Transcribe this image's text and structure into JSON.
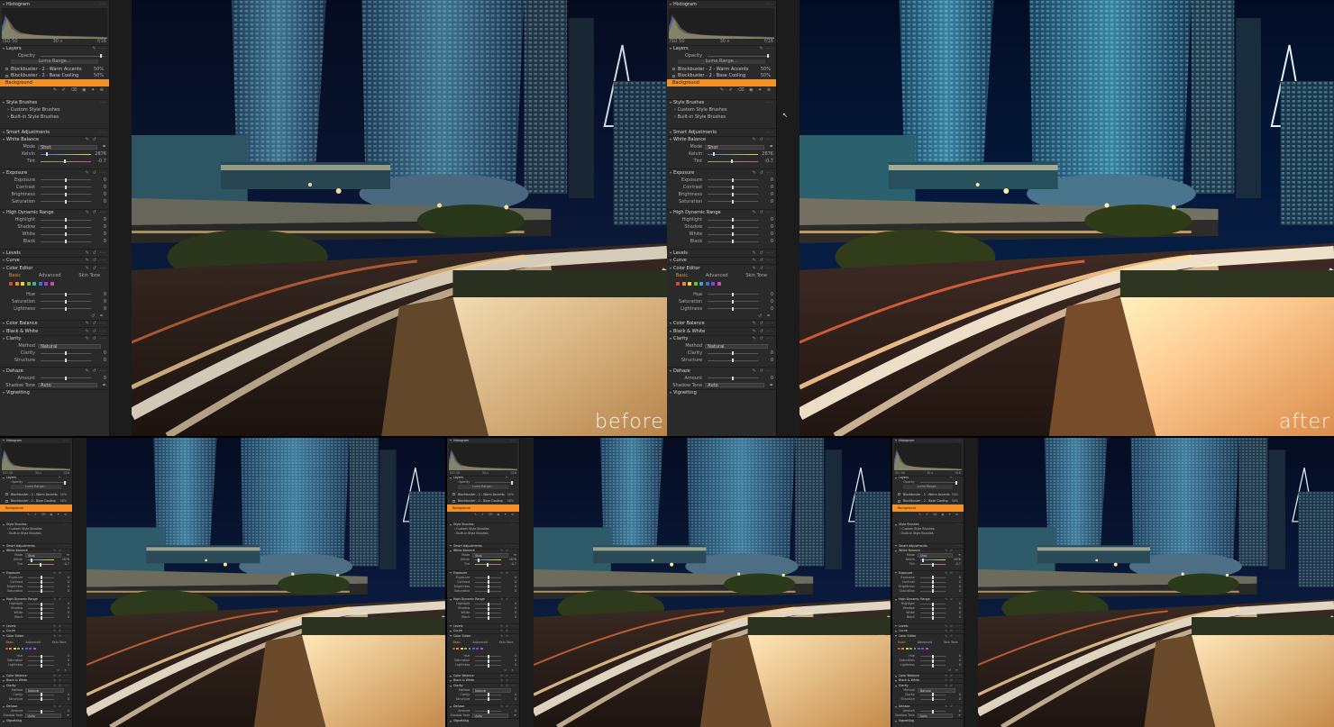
{
  "panel": {
    "histogram_title": "Histogram",
    "iso": "ISO 50",
    "shutter": "30 s",
    "aperture": "f/16",
    "layers_title": "Layers",
    "opacity_label": "Opacity",
    "luma_range": "Luma Range...",
    "layers": [
      {
        "name": "Blockbuster - 2 - Warm Accents",
        "pct": "50%"
      },
      {
        "name": "Blockbuster - 2 - Base Cooling",
        "pct": "50%"
      },
      {
        "name": "Background",
        "pct": ""
      }
    ],
    "style_brushes_title": "Style Brushes",
    "custom_brushes": "Custom Style Brushes",
    "builtin_brushes": "Built-in Style Brushes",
    "smart_adjustments": "Smart Adjustments",
    "white_balance": "White Balance",
    "mode_label": "Mode",
    "mode_value": "Shot",
    "kelvin_label": "Kelvin",
    "kelvin_value": "2876",
    "tint_label": "Tint",
    "tint_value": "-0.7",
    "exposure_title": "Exposure",
    "exposure_rows": [
      "Exposure",
      "Contrast",
      "Brightness",
      "Saturation"
    ],
    "hdr_title": "High Dynamic Range",
    "hdr_rows": [
      "Highlight",
      "Shadow",
      "White",
      "Black"
    ],
    "zero": "0",
    "levels": "Levels",
    "curve": "Curve",
    "color_editor": "Color Editor",
    "tabs": [
      "Basic",
      "Advanced",
      "Skin Tone"
    ],
    "ce_rows": [
      "Hue",
      "Saturation",
      "Lightness"
    ],
    "color_balance": "Color Balance",
    "black_white": "Black & White",
    "clarity_title": "Clarity",
    "method_label": "Method",
    "method_value": "Natural",
    "clarity_rows": [
      "Clarity",
      "Structure"
    ],
    "dehaze": "Dehaze",
    "amount": "Amount",
    "shadow_tone": "Shadow Tone",
    "shadow_tone_value": "Auto",
    "vignetting": "Vignetting"
  },
  "captions": {
    "before": "before",
    "after": "after"
  },
  "swatch_colors": [
    "#e0452f",
    "#f08a2a",
    "#e8d63a",
    "#6dc13a",
    "#36b0a8",
    "#3a6fe0",
    "#8a45d6",
    "#d845b0"
  ],
  "accent": "#f29128"
}
